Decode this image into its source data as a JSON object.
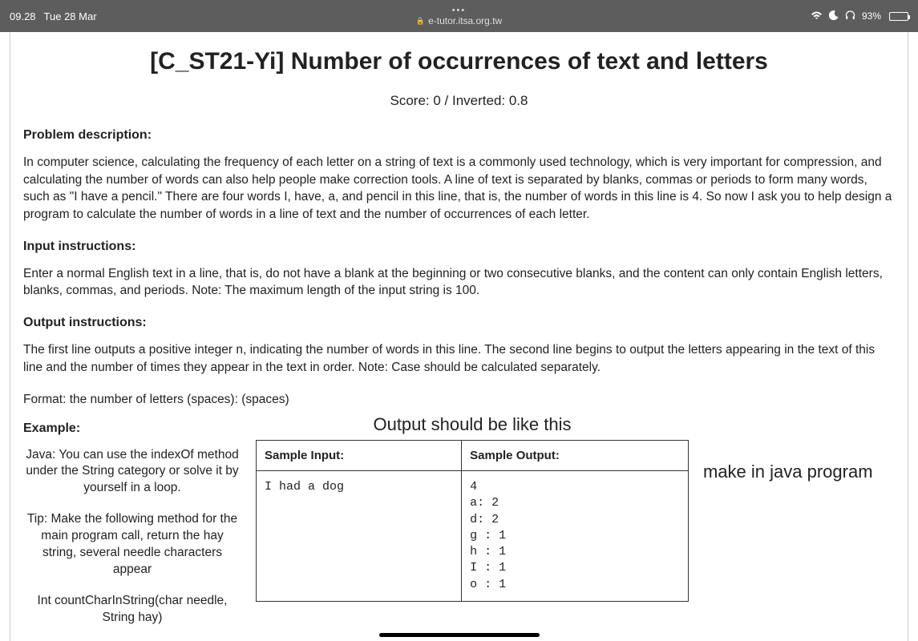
{
  "status": {
    "time": "09.28",
    "date": "Tue 28 Mar",
    "url": "e-tutor.itsa.org.tw",
    "battery_pct": "93%"
  },
  "page": {
    "title": "[C_ST21-Yi] Number of occurrences of text and letters",
    "score_line": "Score: 0 / Inverted: 0.8",
    "h_problem": "Problem description:",
    "p_problem": "In computer science, calculating the frequency of each letter on a string of text is a commonly used technology, which is very important for compression, and calculating the number of words can also help people make correction tools. A line of text is separated by blanks, commas or periods to form many words, such as \"I have a pencil.\" There are four words I, have, a, and pencil in this line, that is, the number of words in this line is 4. So now I ask you to help design a program to calculate the number of words in a line of text and the number of occurrences of each letter.",
    "h_input": "Input instructions:",
    "p_input": "Enter a normal English text in a line, that is, do not have a blank at the beginning or two consecutive blanks, and the content can only contain English letters, blanks, commas, and periods. Note: The maximum length of the input string is 100.",
    "h_output": "Output instructions:",
    "p_output": "The first line outputs a positive integer n, indicating the number of words in this line. The second line begins to output the letters appearing in the text of this line and the number of times they appear in the text in order. Note: Case should be calculated separately.",
    "format_line": "Format: the number of letters (spaces): (spaces)",
    "h_example": "Example:"
  },
  "tips": {
    "java_hint": "Java: You can use the indexOf method under the String category or solve it by yourself in a loop.",
    "tip": "Tip: Make the following method for the main program call, return the hay string, several needle characters appear",
    "sig": "Int countCharInString(char needle, String hay)"
  },
  "annot": {
    "output_like": "Output should be like this",
    "make_java": "make in java program"
  },
  "table": {
    "th_input": "Sample Input:",
    "th_output": "Sample Output:",
    "sample_input": "I had a dog",
    "out": {
      "l0": "4",
      "l1": "a: 2",
      "l2": "d: 2",
      "l3": "g : 1",
      "l4": "h : 1",
      "l5": "I : 1",
      "l6": "o : 1"
    }
  }
}
